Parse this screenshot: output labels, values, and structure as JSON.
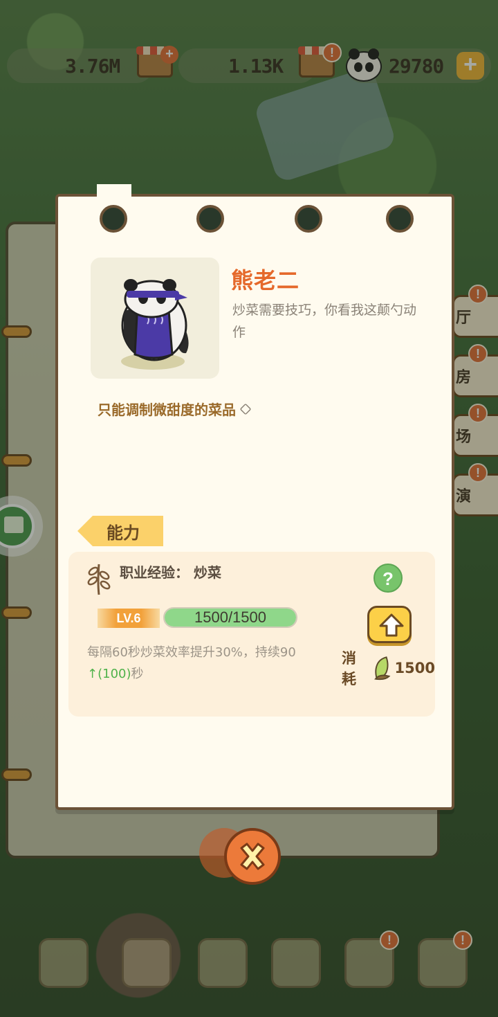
{
  "resources": {
    "coins": "3.76M",
    "bamboo": "1.13K",
    "pandas": "29780"
  },
  "side_tabs": [
    {
      "label": "厅",
      "alert": "!"
    },
    {
      "label": "房",
      "alert": "!"
    },
    {
      "label": "场",
      "alert": "!"
    },
    {
      "label": "演",
      "alert": "!"
    }
  ],
  "card": {
    "name": "熊老二",
    "description": "炒菜需要技巧，你看我这颠勺动作",
    "ability_note": "只能调制微甜度的菜品",
    "section_tab": "能力",
    "skill": {
      "title": "职业经验：",
      "profession": "炒菜",
      "level": "LV.6",
      "xp_text": "1500/1500",
      "xp_fraction": 1.0,
      "desc_main": "每隔60秒炒菜效率提升30%，持续90",
      "desc_upgrade_arrow": "↑",
      "desc_upgrade": "(100)",
      "desc_unit": "秒",
      "help": "?",
      "cost_label": "消耗",
      "cost_value": "1500"
    }
  },
  "colors": {
    "accent_orange": "#e5692b",
    "card_bg": "#fffbef",
    "xp_green": "#8fd78a",
    "tab_yellow": "#fbd16a"
  },
  "icons": [
    "plus-icon",
    "alert-icon",
    "panda-icon",
    "bamboo-icon",
    "leaf-icon",
    "arrow-up-icon",
    "close-icon",
    "book-icon",
    "info-cube-icon"
  ]
}
